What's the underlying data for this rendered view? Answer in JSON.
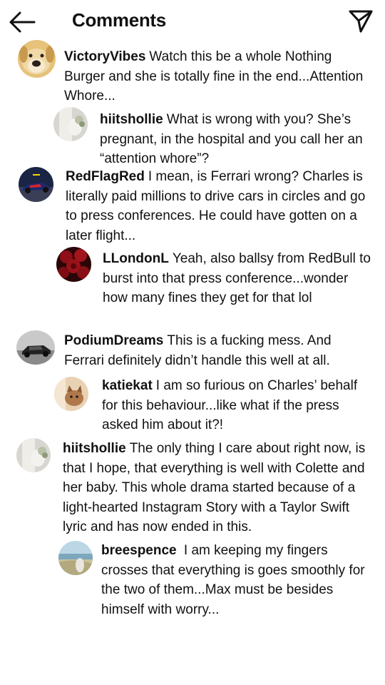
{
  "header": {
    "title": "Comments",
    "back_icon": "arrow-left-icon",
    "send_icon": "paper-plane-icon"
  },
  "comments": [
    {
      "username": "VictoryVibes",
      "text": "Watch this be a whole Nothing Burger and she is totally fine in the end...Attention Whore...",
      "avatar": "dog"
    },
    {
      "username": "hiitshollie",
      "text": "What is wrong with you? She’s pregnant, in the hospital and you call her an “attention whore”?",
      "avatar": "bride"
    },
    {
      "username": "RedFlagRed",
      "text": "I mean, is Ferrari wrong? Charles is literally paid millions to drive cars in circles and go to press conferences. He could have gotten on a later flight...",
      "avatar": "race-car"
    },
    {
      "username": "LLondonL",
      "text": "Yeah, also ballsy from RedBull to burst into that press conference...wonder how many fines they get for that lol",
      "avatar": "roses"
    },
    {
      "username": "PodiumDreams",
      "text": "This is a fucking mess. And Ferrari definitely didn’t handle this well at all.",
      "avatar": "sports-car"
    },
    {
      "username": "katiekat",
      "text": "I am so furious on Charles’ behalf for this behaviour...like what if the press asked him about it?!",
      "avatar": "cat"
    },
    {
      "username": "hiitshollie",
      "text": "The only thing I care about right now, is that I hope, that everything is well with Colette and her baby. This whole drama started because of a light-hearted Instagram Story with a Taylor Swift lyric and has now ended in this.",
      "avatar": "bride"
    },
    {
      "username": "breespence",
      "text": " I am keeping my fingers crosses that everything is goes smoothly for the two of them...Max must be besides himself with worry...",
      "avatar": "beach"
    }
  ]
}
